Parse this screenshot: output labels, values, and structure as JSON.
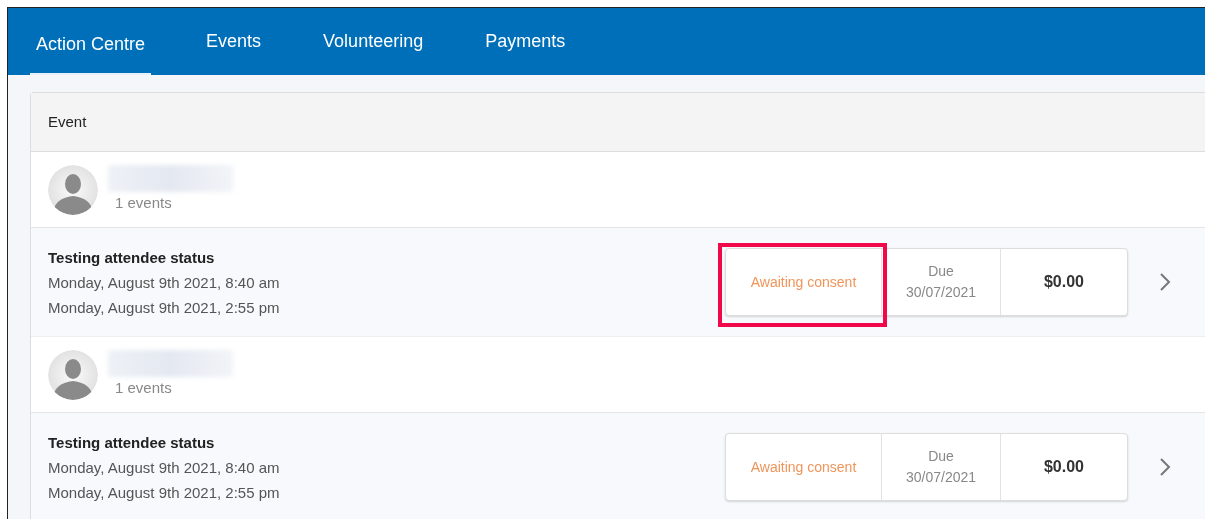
{
  "tabs": [
    {
      "label": "Action Centre",
      "selected": true
    },
    {
      "label": "Events",
      "selected": false
    },
    {
      "label": "Volunteering",
      "selected": false
    },
    {
      "label": "Payments",
      "selected": false
    }
  ],
  "table": {
    "header": "Event",
    "groups": [
      {
        "count": "1 events",
        "events": [
          {
            "title": "Testing attendee status",
            "start": "Monday, August 9th 2021, 8:40 am",
            "end": "Monday, August 9th 2021, 2:55 pm",
            "status": "Awaiting consent",
            "due_label": "Due",
            "due_date": "30/07/2021",
            "amount": "$0.00",
            "highlighted": true
          }
        ]
      },
      {
        "count": "1 events",
        "events": [
          {
            "title": "Testing attendee status",
            "start": "Monday, August 9th 2021, 8:40 am",
            "end": "Monday, August 9th 2021, 2:55 pm",
            "status": "Awaiting consent",
            "due_label": "Due",
            "due_date": "30/07/2021",
            "amount": "$0.00",
            "highlighted": false
          }
        ]
      }
    ]
  }
}
